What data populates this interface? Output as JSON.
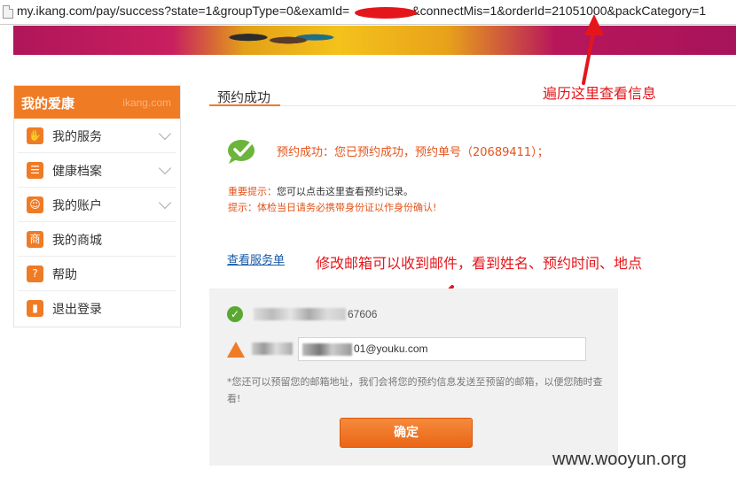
{
  "browser": {
    "url": "my.ikang.com/pay/success?state=1&groupType=0&examId=",
    "url_after_redaction": "&connectMis=1&orderId=21051000&packCategory=1"
  },
  "sidebar": {
    "title": "我的爱康",
    "brand": "ikang.com",
    "items": [
      {
        "label": "我的服务",
        "icon": "hand-icon",
        "glyph": "✋",
        "expandable": true
      },
      {
        "label": "健康档案",
        "icon": "list-icon",
        "glyph": "☰",
        "expandable": true
      },
      {
        "label": "我的账户",
        "icon": "smile-icon",
        "glyph": "☺",
        "expandable": true
      },
      {
        "label": "我的商城",
        "icon": "shop-icon",
        "glyph": "商",
        "expandable": false
      },
      {
        "label": "帮助",
        "icon": "bulb-icon",
        "glyph": "?",
        "expandable": false
      },
      {
        "label": "退出登录",
        "icon": "door-icon",
        "glyph": "▮",
        "expandable": false
      }
    ]
  },
  "main": {
    "tab_title": "预约成功",
    "success_message": "预约成功：您已预约成功，预约单号（20689411）；",
    "notice_important_key": "重要提示：",
    "notice_important_text": "您可以点击这里查看预约记录。",
    "notice_tip": "提示：体检当日请务必携带身份证以作身份确认!",
    "view_order_link": "查看服务单",
    "panel": {
      "phone_suffix": "67606",
      "email_value": "01@youku.com",
      "note": "*您还可以预留您的邮箱地址，我们会将您的预约信息发送至预留的邮箱，以便您随时查看!",
      "confirm_button": "确定"
    }
  },
  "annotations": {
    "iterate_hint": "遍历这里查看信息",
    "email_hint": "修改邮箱可以收到邮件，看到姓名、预约时间、地点"
  },
  "watermark": "www.wooyun.org",
  "colors": {
    "accent": "#f07b25",
    "annotation_red": "#e4161b",
    "link_blue": "#175aa6"
  }
}
